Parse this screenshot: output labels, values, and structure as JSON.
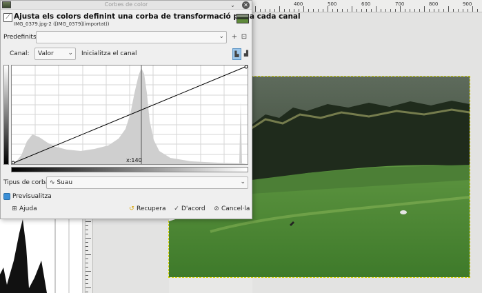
{
  "dialog": {
    "window_title": "Corbes de color",
    "header_title": "Ajusta els colors definint una corba de transformació per a cada canal",
    "header_subtitle": "IMG_0379.jpg-2 ([IMG_0379](importat))",
    "presets_label": "Predefinits:",
    "presets_value": "",
    "channel_label": "Canal:",
    "channel_value": "Valor",
    "reset_channel_label": "Inicialitza el canal",
    "curve_readout": "x:140",
    "curve_type_label": "Tipus de corba:",
    "curve_type_value": "Suau",
    "preview_label": "Previsualitza",
    "preview_checked": true,
    "help_label": "Ajuda",
    "reset_label": "Recupera",
    "ok_label": "D'acord",
    "cancel_label": "Cancel·la",
    "icons": {
      "app": "gimp-image-icon",
      "tool": "curves-tool-icon",
      "add_preset": "plus-icon",
      "manage_presets": "menu-icon",
      "linear_histogram": "linear-histogram-icon",
      "log_histogram": "log-histogram-icon",
      "help": "help-icon",
      "reset": "reset-icon",
      "ok": "check-icon",
      "cancel": "cancel-icon"
    },
    "colors": {
      "accent": "#3b8fd6",
      "histogram_fill": "#cfcfcf"
    }
  },
  "ruler": {
    "labels": [
      "400",
      "500",
      "600",
      "700",
      "800",
      "900"
    ]
  }
}
